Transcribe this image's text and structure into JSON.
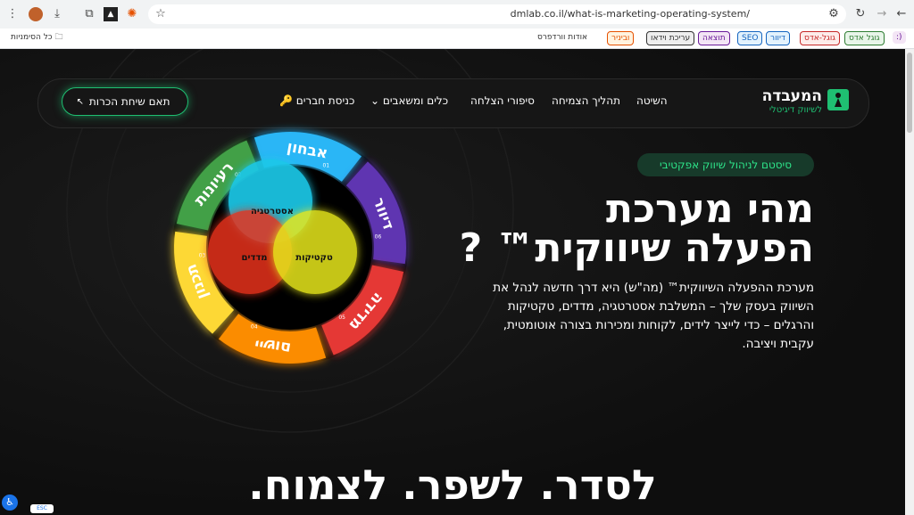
{
  "browser": {
    "url": "dmlab.co.il/what-is-marketing-operating-system/",
    "bookmarks": [
      {
        "label": "גוגל אדס",
        "color": "#2e7d32",
        "bg": "#e8f5e9"
      },
      {
        "label": "גוגל-אדס",
        "color": "#c62828",
        "bg": "#fdecea"
      },
      {
        "label": "דיוור",
        "color": "#1565c0",
        "bg": "#e3f2fd"
      },
      {
        "label": "SEO",
        "color": "#1565c0",
        "bg": "#e3f2fd"
      },
      {
        "label": "תוצאה",
        "color": "#6a1b9a",
        "bg": "#f3e5f5"
      },
      {
        "label": "עריכת וידאו",
        "color": "#333333",
        "bg": "#eeeeee"
      },
      {
        "label": "וביניר",
        "color": "#e65100",
        "bg": "#fff3e0"
      }
    ],
    "bookmark_wp": "אודות וורדפרס",
    "all_bookmarks": "כל הסימניות"
  },
  "nav": {
    "items": [
      "השיטה",
      "תהליך הצמיחה",
      "סיפורי הצלחה",
      "כלים ומשאבים",
      "כניסת חברים"
    ],
    "cta": "תאם שיחת הכרות",
    "logo_main": "המעבדה",
    "logo_sub": "לשיווק דיגיטלי"
  },
  "hero": {
    "badge": "סיסטם לניהול שיווק אפקטיבי",
    "title_line1": "מהי מערכת",
    "title_line2": "הפעלה שיווקית™ ?",
    "description": "מערכת ההפעלה השיווקית™ (מה\"ש) היא דרך חדשה לנהל את השיווק בעסק שלך – המשלבת אסטרטגיה, מדדים, טקטיקות והרגלים – כדי לייצר לידים, לקוחות ומכירות בצורה אוטומטית, עקבית ויציבה."
  },
  "wheel": {
    "segments": [
      {
        "label": "אבחון",
        "num": "01",
        "color": "#29b6f6"
      },
      {
        "label": "דיוור",
        "num": "06",
        "color": "#5e35b1"
      },
      {
        "label": "מדידה",
        "num": "05",
        "color": "#e53935"
      },
      {
        "label": "יישום",
        "num": "04",
        "color": "#fb8c00"
      },
      {
        "label": "תכנון",
        "num": "03",
        "color": "#fdd835"
      },
      {
        "label": "רעיונות",
        "num": "02",
        "color": "#43a047"
      }
    ],
    "circles": [
      "אסטרטגיה",
      "מדדים",
      "טקטיקות"
    ]
  },
  "bottom": {
    "title": "לסדר. לשפר. לצמוח."
  },
  "esc": "ESC"
}
